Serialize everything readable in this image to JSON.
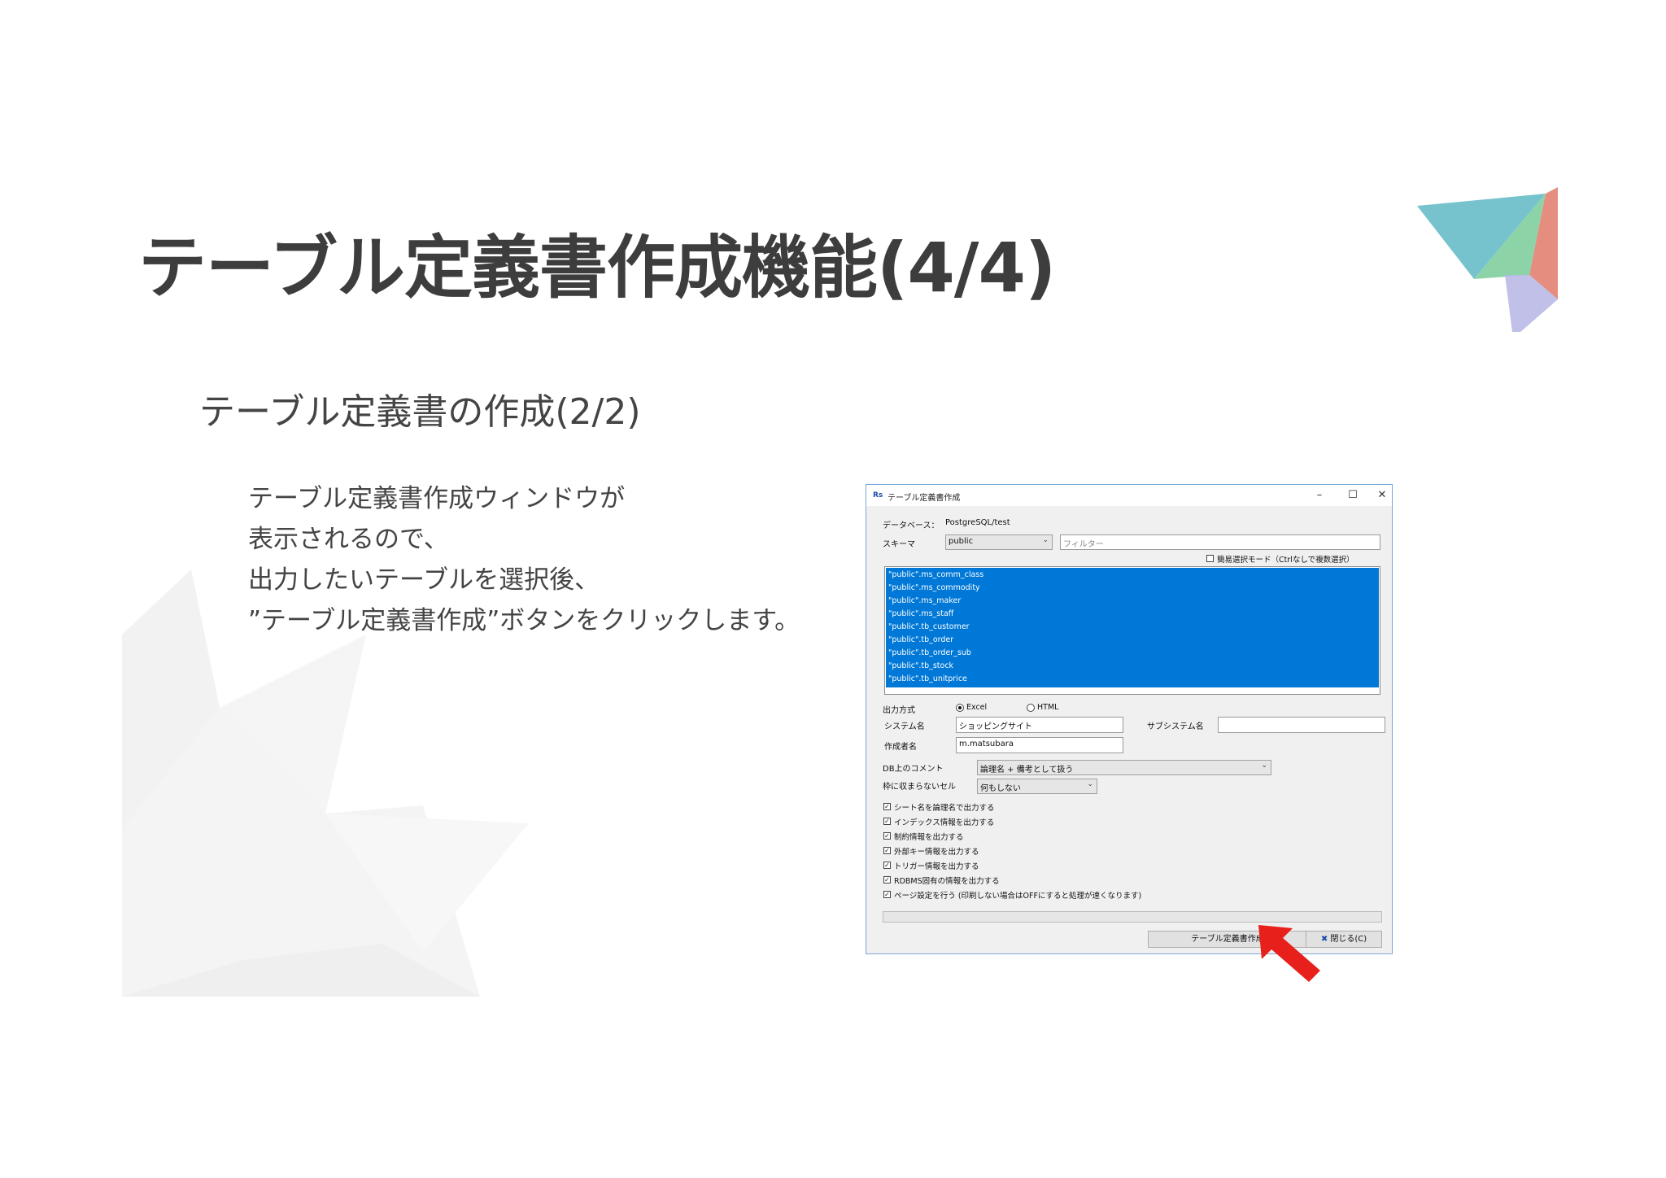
{
  "slide": {
    "title": "テーブル定義書作成機能(4/4)",
    "subtitle": "テーブル定義書の作成(2/2)",
    "body_lines": [
      "テーブル定義書作成ウィンドウが",
      "表示されるので、",
      "出力したいテーブルを選択後、",
      "”テーブル定義書作成”ボタンをクリックします。"
    ]
  },
  "dialog": {
    "app_icon_text": "Rs",
    "title": "テーブル定義書作成",
    "window_buttons": {
      "minimize": "–",
      "maximize": "☐",
      "close": "✕"
    },
    "database_label": "データベース：",
    "database_value": "PostgreSQL/test",
    "schema_label": "スキーマ",
    "schema_value": "public",
    "filter_placeholder": "フィルター",
    "simple_mode_label": "簡易選択モード（Ctrlなしで複数選択）",
    "tables": [
      "\"public\".ms_comm_class",
      "\"public\".ms_commodity",
      "\"public\".ms_maker",
      "\"public\".ms_staff",
      "\"public\".tb_customer",
      "\"public\".tb_order",
      "\"public\".tb_order_sub",
      "\"public\".tb_stock",
      "\"public\".tb_unitprice"
    ],
    "output_format_label": "出力方式",
    "format_excel": "Excel",
    "format_html": "HTML",
    "system_name_label": "システム名",
    "system_name_value": "ショッピングサイト",
    "subsystem_name_label": "サブシステム名",
    "subsystem_name_value": "",
    "author_label": "作成者名",
    "author_value": "m.matsubara",
    "db_comment_label": "DB上のコメント",
    "db_comment_value": "論理名 + 備考として扱う",
    "overflow_cell_label": "枠に収まらないセル",
    "overflow_cell_value": "何もしない",
    "options": [
      "シート名を論理名で出力する",
      "インデックス情報を出力する",
      "制約情報を出力する",
      "外部キー情報を出力する",
      "トリガー情報を出力する",
      "RDBMS固有の情報を出力する",
      "ページ設定を行う (印刷しない場合はOFFにすると処理が速くなります)"
    ],
    "create_button": "テーブル定義書作成",
    "close_button": "閉じる(C)",
    "check_mark": "✓",
    "combo_arrow": "⌄",
    "close_button_icon": "✖"
  },
  "colors": {
    "selection_blue": "#0078d7",
    "arrow_red": "#e8201c",
    "logo_teal": "#5fb8c4",
    "logo_green": "#7fcf9f",
    "logo_red": "#e07a6a",
    "logo_lavender": "#b9b9e6"
  }
}
